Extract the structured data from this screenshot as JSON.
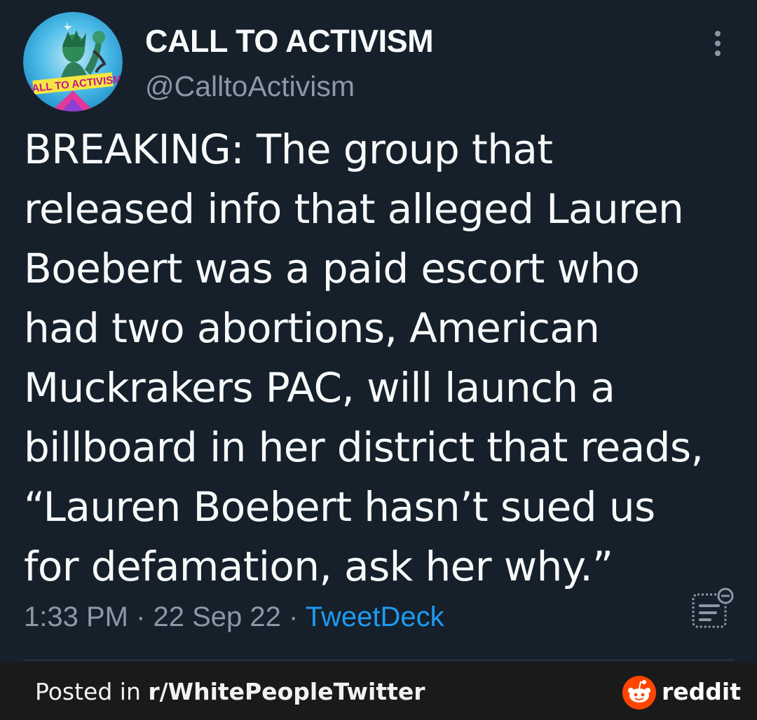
{
  "tweet": {
    "display_name": "CALL TO ACTIVISM",
    "handle": "@CalltoActivism",
    "avatar_badge_text": "CALL TO ACTIVISM",
    "text": "BREAKING: The group that\nreleased info that alleged Lauren\nBoebert was a paid escort who\nhad two abortions, American\nMuckrakers PAC, will launch a\nbillboard in her district that reads,\n“Lauren Boebert hasn’t sued us\nfor defamation, ask her why.”",
    "time": "1:33 PM",
    "date": "22 Sep 22",
    "separator": " · ",
    "source": "TweetDeck",
    "icons": {
      "more": "more-vertical-icon",
      "analytics": "tweet-analytics-icon"
    }
  },
  "footer": {
    "posted_prefix": "Posted in ",
    "subreddit": "r/WhitePeopleTwitter",
    "brand": "reddit",
    "icon": "reddit-snoo-icon"
  },
  "colors": {
    "background": "#15202b",
    "text": "#f7f9f9",
    "secondary": "#8b98a5",
    "link": "#1d9bf0",
    "footer_bg": "#1a1a1b",
    "reddit_orange": "#ff4500"
  }
}
